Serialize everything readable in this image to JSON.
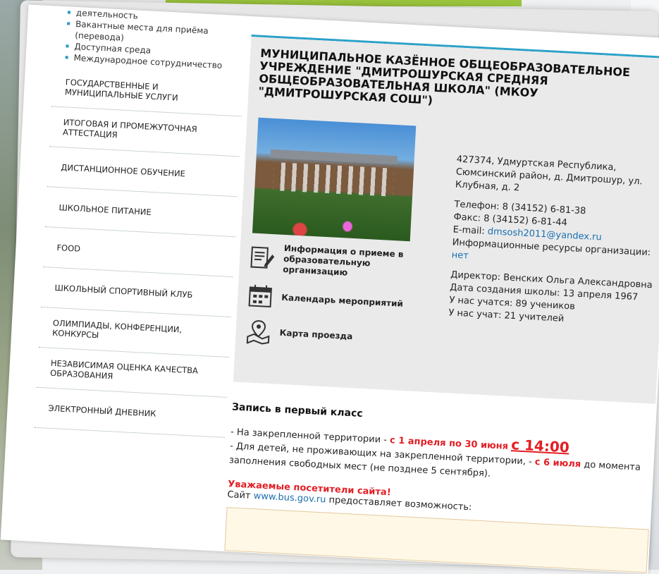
{
  "sidebar": {
    "sub_items": [
      "деятельность",
      "Вакантные места для приёма (перевода)",
      "Доступная среда",
      "Международное сотрудничество"
    ],
    "nav": [
      "ГОСУДАРСТВЕННЫЕ И МУНИЦИПАЛЬНЫЕ УСЛУГИ",
      "ИТОГОВАЯ И ПРОМЕЖУТОЧНАЯ АТТЕСТАЦИЯ",
      "ДИСТАНЦИОННОЕ ОБУЧЕНИЕ",
      "ШКОЛЬНОЕ ПИТАНИЕ",
      "FOOD",
      "ШКОЛЬНЫЙ СПОРТИВНЫЙ КЛУБ",
      "ОЛИМПИАДЫ, КОНФЕРЕНЦИИ, КОНКУРСЫ",
      "НЕЗАВИСИМАЯ ОЦЕНКА КАЧЕСТВА ОБРАЗОВАНИЯ",
      "ЭЛЕКТРОННЫЙ ДНЕВНИК"
    ]
  },
  "school": {
    "title": "МУНИЦИПАЛЬНОЕ КАЗЁННОЕ ОБЩЕОБРАЗОВАТЕЛЬНОЕ УЧРЕЖДЕНИЕ \"ДМИТРОШУРСКАЯ СРЕДНЯЯ ОБЩЕОБРАЗОВАТЕЛЬНАЯ ШКОЛА\" (МКОУ \"ДМИТРОШУРСКАЯ СОШ\")",
    "links": [
      {
        "label": "Информация о приеме в образовательную организацию",
        "icon": "document-edit-icon"
      },
      {
        "label": "Календарь мероприятий",
        "icon": "calendar-icon"
      },
      {
        "label": "Карта проезда",
        "icon": "map-pin-icon"
      }
    ],
    "address": "427374, Удмуртская Республика, Сюмсинский район, д. Дмитрошур, ул. Клубная, д. 2",
    "phone": "Телефон: 8 (34152) 6-81-38",
    "fax": "Факс: 8 (34152) 6-81-44",
    "email_label": "E-mail:",
    "email": "dmsosh2011@yandex.ru",
    "resources_label": "Информационные ресурсы организации:",
    "resources_value": "нет",
    "director": "Директор: Венских Ольга Александровна",
    "founded": "Дата создания школы: 13 апреля 1967",
    "students": "У нас учатся: 89 учеников",
    "teachers": "У нас учат: 21 учителей"
  },
  "enrollment": {
    "heading": "Запись в первый класс",
    "line1_prefix": "- На закрепленной территории -",
    "line1_dates": "с 1 апреля по 30 июня",
    "line1_time": "с 14:00",
    "line2_prefix": "- Для детей, не проживающих на закрепленной территории, -",
    "line2_date": "с 6 июля",
    "line2_suffix": "до момента заполнения свободных мест (не позднее 5 сентября)."
  },
  "notice": {
    "dear": "Уважаемые посетители сайта!",
    "site_prefix": "Сайт",
    "site_link": "www.bus.gov.ru",
    "site_suffix": "предоставляет возможность:"
  },
  "colors": {
    "accent_blue": "#2aa1c9",
    "accent_red": "#e31e24",
    "top_bar_green": "#9bc53d"
  }
}
